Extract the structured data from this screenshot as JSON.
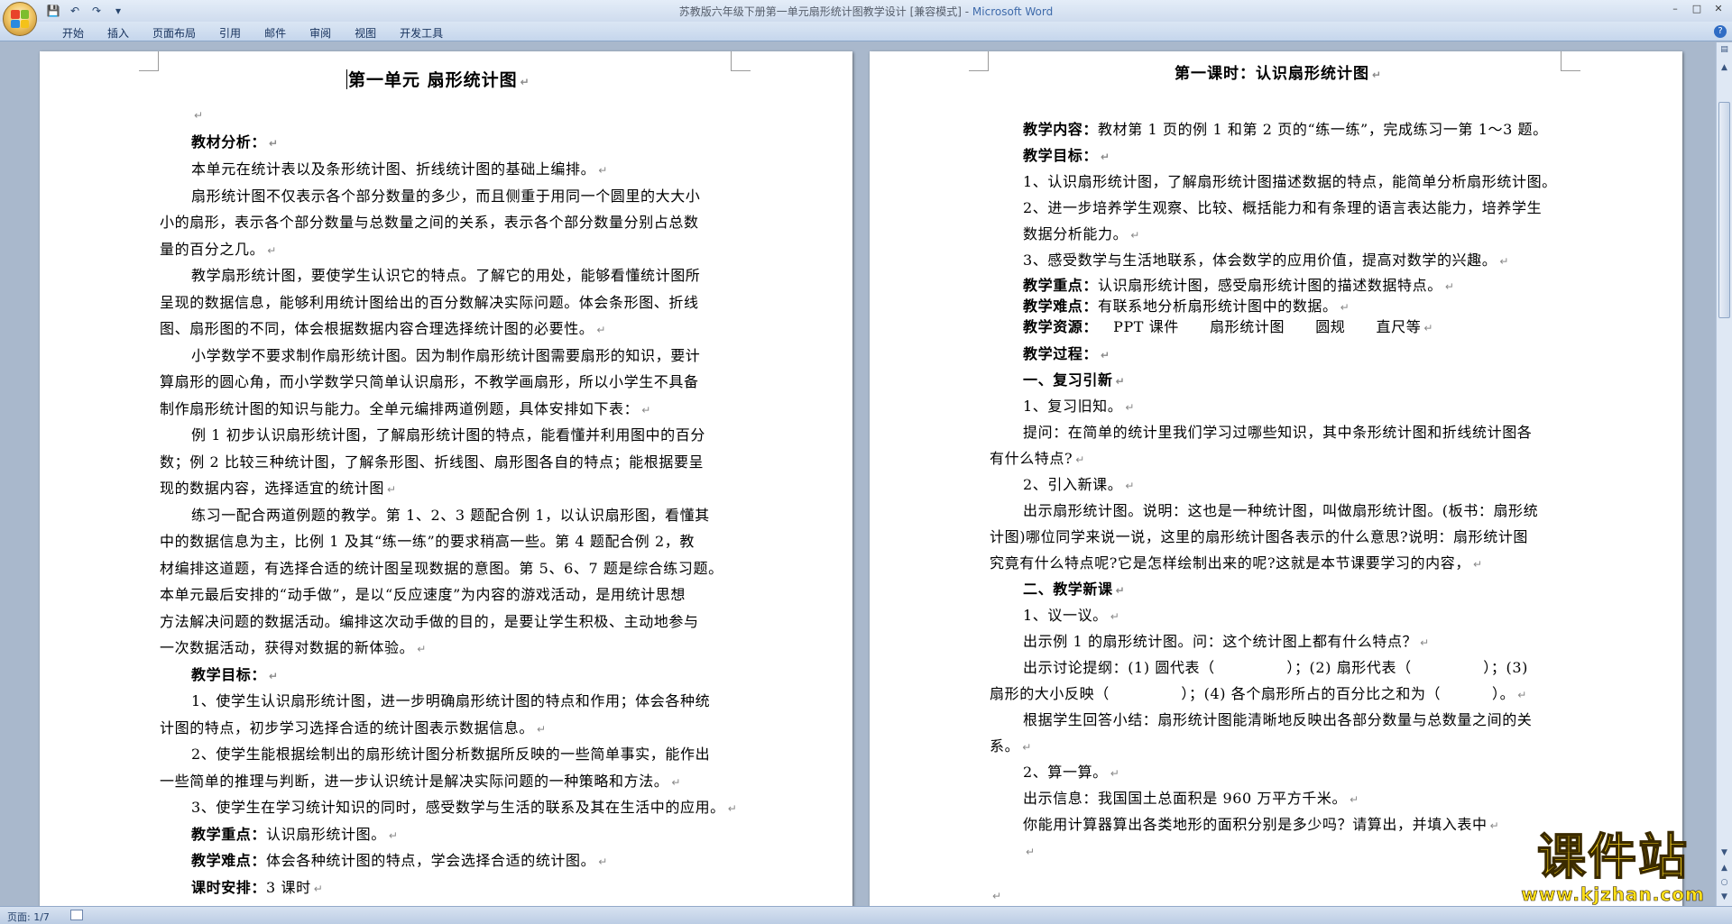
{
  "window": {
    "title": "苏教版六年级下册第一单元扇形统计图教学设计 [兼容模式] - ",
    "app_name": "Microsoft Word"
  },
  "ribbon": {
    "tabs": [
      "开始",
      "插入",
      "页面布局",
      "引用",
      "邮件",
      "审阅",
      "视图",
      "开发工具"
    ]
  },
  "status": {
    "page_info": "页面: 1/7"
  },
  "left_page": {
    "title": "第一单元    扇形统计图",
    "lines": [
      "",
      "教材分析：",
      "本单元在统计表以及条形统计图、折线统计图的基础上编排。",
      "扇形统计图不仅表示各个部分数量的多少，而且侧重于用同一个圆里的大大小",
      "小的扇形，表示各个部分数量与总数量之间的关系，表示各个部分数量分别占总数",
      "量的百分之几。",
      "教学扇形统计图，要使学生认识它的特点。了解它的用处，能够看懂统计图所",
      "呈现的数据信息，能够利用统计图给出的百分数解决实际问题。体会条形图、折线",
      "图、扇形图的不同，体会根据数据内容合理选择统计图的必要性。",
      "小学数学不要求制作扇形统计图。因为制作扇形统计图需要扇形的知识，要计",
      "算扇形的圆心角，而小学数学只简单认识扇形，不教学画扇形，所以小学生不具备",
      "制作扇形统计图的知识与能力。全单元编排两道例题，具体安排如下表：",
      "例 1 初步认识扇形统计图，了解扇形统计图的特点，能看懂并利用图中的百分",
      "数；例 2 比较三种统计图，了解条形图、折线图、扇形图各自的特点；能根据要呈",
      "现的数据内容，选择适宜的统计图",
      "练习一配合两道例题的教学。第 1、2、3 题配合例 1，以认识扇形图，看懂其",
      "中的数据信息为主，比例 1 及其“练一练”的要求稍高一些。第 4 题配合例 2，教",
      "材编排这道题，有选择合适的统计图呈现数据的意图。第 5、6、7 题是综合练习题。",
      "本单元最后安排的“动手做”，是以“反应速度”为内容的游戏活动，是用统计思想",
      "方法解决问题的数据活动。编排这次动手做的目的，是要让学生积极、主动地参与",
      "一次数据活动，获得对数据的新体验。",
      "教学目标：",
      "1、使学生认识扇形统计图，进一步明确扇形统计图的特点和作用；体会各种统",
      "计图的特点，初步学习选择合适的统计图表示数据信息。",
      "2、使学生能根据绘制出的扇形统计图分析数据所反映的一些简单事实，能作出",
      "一些简单的推理与判断，进一步认识统计是解决实际问题的一种策略和方法。",
      "3、使学生在学习统计知识的同时，感受数学与生活的联系及其在生活中的应用。",
      "教学重点：",
      "认识扇形统计图。",
      "教学难点：",
      "体会各种统计图的特点，学会选择合适的统计图。",
      "课时安排：",
      "3 课时"
    ]
  },
  "right_page": {
    "title": "第一课时：认识扇形统计图",
    "lines": [
      "教学内容：",
      "教材第 1 页的例 1 和第 2 页的“练一练”，完成练习一第 1～3 题。",
      "教学目标：",
      "1、认识扇形统计图，了解扇形统计图描述数据的特点，能简单分析扇形统计图。",
      "2、进一步培养学生观察、比较、概括能力和有条理的语言表达能力，培养学生",
      "数据分析能力。",
      "3、感受数学与生活地联系，体会数学的应用价值，提高对数学的兴趣。",
      "教学重点：",
      "认识扇形统计图，感受扇形统计图的描述数据特点。",
      "教学难点：",
      "有联系地分析扇形统计图中的数据。",
      "教学资源：",
      "PPT 课件      扇形统计图      圆规      直尺等",
      "教学过程：",
      "一、复习引新",
      "1、复习旧知。",
      "提问：在简单的统计里我们学习过哪些知识，其中条形统计图和折线统计图各",
      "有什么特点?",
      "2、引入新课。",
      "出示扇形统计图。说明：这也是一种统计图，叫做扇形统计图。(板书：扇形统",
      "计图)哪位同学来说一说，这里的扇形统计图各表示的什么意思?说明：扇形统计图",
      "究竟有什么特点呢?它是怎样绘制出来的呢?这就是本节课要学习的内容，",
      "二、教学新课",
      "1、议一议。",
      "出示例 1 的扇形统计图。问：这个统计图上都有什么特点？",
      "出示讨论提纲：(1) 圆代表（              ）；(2) 扇形代表（              ）；(3)",
      "扇形的大小反映（              ）；(4) 各个扇形所占的百分比之和为（          ）。",
      "根据学生回答小结：扇形统计图能清晰地反映出各部分数量与总数量之间的关",
      "系。",
      "2、算一算。",
      "出示信息：我国国土总面积是 960 万平方千米。",
      "你能用计算器算出各类地形的面积分别是多少吗？请算出，并填入表中"
    ]
  },
  "watermark": {
    "text": "课件站",
    "url": "www.kjzhan.com"
  },
  "colors": {
    "background": "#a9b8cc",
    "ribbon": "#c5d6ec",
    "watermark": "#f7d21a"
  }
}
